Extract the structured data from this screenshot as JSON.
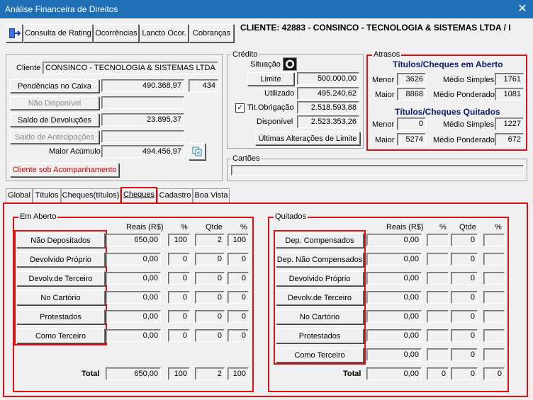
{
  "window": {
    "title": "Análise Financeira de Direitos",
    "close": "✕"
  },
  "toolbar": {
    "items": [
      "Consulta de Rating",
      "Ocorrências",
      "Lancto Ocor.",
      "Cobranças"
    ],
    "client_header": "CLIENTE: 42883 - CONSINCO - TECNOLOGIA & SISTEMAS LTDA  /  I"
  },
  "cliente": {
    "label": "Cliente",
    "name": "CONSINCO - TECNOLOGIA & SISTEMAS LTDA",
    "pendencias_btn": "Pendências no Caixa",
    "pendencias_val": "490.368,97",
    "pendencias_qtd": "434",
    "nao_disponivel_btn": "Não Disponível",
    "nao_disponivel_val": "",
    "saldo_devolucoes_btn": "Saldo de Devoluções",
    "saldo_devolucoes_val": "23.895,37",
    "saldo_antecipacoes_btn": "Saldo de Antecipações",
    "saldo_antecipacoes_val": "",
    "maior_acumulo_label": "Maior Acúmulo",
    "maior_acumulo_val": "494.456,97",
    "acompanhamento_btn": "Cliente sob Acompanhamento"
  },
  "credito": {
    "title": "Crédito",
    "situacao_label": "Situação",
    "limite_btn": "Limite",
    "limite_val": "500.000,00",
    "utilizado_label": "Utilizado",
    "utilizado_val": "495.240,62",
    "tit_obrig_label": "Tit.Obrigação",
    "tit_obrig_checked": true,
    "tit_obrig_val": "2.518.593,88",
    "disponivel_label": "Disponível",
    "disponivel_val": "2.523.353,26",
    "ultimas_btn": "Últimas Alterações de Limite"
  },
  "atrasos": {
    "title": "Atrasos",
    "aberto_title": "Títulos/Cheques em Aberto",
    "quitados_title": "Títulos/Cheques Quitados",
    "menor_label": "Menor",
    "maior_label": "Maior",
    "medio_simples_label": "Médio Simples",
    "medio_ponderado_label": "Médio Ponderado",
    "aberto": {
      "menor": "3626",
      "maior": "8868",
      "medio_simples": "1761",
      "medio_ponderado": "1081"
    },
    "quitados": {
      "menor": "0",
      "maior": "5274",
      "medio_simples": "1227",
      "medio_ponderado": "672"
    }
  },
  "cartoes": {
    "title": "Cartões",
    "value": ""
  },
  "tabs": [
    "Global",
    "Títulos",
    "Cheques(títulos)",
    "Cheques",
    "Cadastro",
    "Boa Vista"
  ],
  "active_tab": "Cheques",
  "em_aberto": {
    "title": "Em Aberto",
    "headers": {
      "reais": "Reais (R$)",
      "pct1": "%",
      "qtde": "Qtde",
      "pct2": "%"
    },
    "rows": [
      {
        "label": "Não Depositados",
        "reais": "650,00",
        "pct1": "100",
        "qtde": "2",
        "pct2": "100"
      },
      {
        "label": "Devolvido Próprio",
        "reais": "0,00",
        "pct1": "0",
        "qtde": "0",
        "pct2": "0"
      },
      {
        "label": "Devolv.de Terceiro",
        "reais": "0,00",
        "pct1": "0",
        "qtde": "0",
        "pct2": "0"
      },
      {
        "label": "No Cartório",
        "reais": "0,00",
        "pct1": "0",
        "qtde": "0",
        "pct2": "0"
      },
      {
        "label": "Protestados",
        "reais": "0,00",
        "pct1": "0",
        "qtde": "0",
        "pct2": "0"
      },
      {
        "label": "Como Terceiro",
        "reais": "0,00",
        "pct1": "0",
        "qtde": "0",
        "pct2": "0"
      }
    ],
    "total_label": "Total",
    "total": {
      "reais": "650,00",
      "pct1": "100",
      "qtde": "2",
      "pct2": "100"
    }
  },
  "quitados": {
    "title": "Quitados",
    "headers": {
      "reais": "Reais (R$)",
      "pct1": "%",
      "qtde": "Qtde",
      "pct2": "%"
    },
    "rows": [
      {
        "label": "Dep. Compensados",
        "reais": "0,00",
        "pct1": "",
        "qtde": "0",
        "pct2": ""
      },
      {
        "label": "Dep. Não Compensados",
        "reais": "0,00",
        "pct1": "",
        "qtde": "0",
        "pct2": ""
      },
      {
        "label": "Devolvido Próprio",
        "reais": "0,00",
        "pct1": "",
        "qtde": "0",
        "pct2": ""
      },
      {
        "label": "Devolv.de Terceiro",
        "reais": "0,00",
        "pct1": "",
        "qtde": "0",
        "pct2": ""
      },
      {
        "label": "No Cartório",
        "reais": "0,00",
        "pct1": "",
        "qtde": "0",
        "pct2": ""
      },
      {
        "label": "Protestados",
        "reais": "0,00",
        "pct1": "",
        "qtde": "0",
        "pct2": ""
      },
      {
        "label": "Como Terceiro",
        "reais": "0,00",
        "pct1": "",
        "qtde": "0",
        "pct2": ""
      }
    ],
    "total_label": "Total",
    "total": {
      "reais": "0,00",
      "pct1": "0",
      "qtde": "0",
      "pct2": "0"
    }
  },
  "colors": {
    "titlebar": "#1e6fb5",
    "highlight_red": "#d11111",
    "heading_navy": "#0a1e6e",
    "alert_text": "#d00000"
  }
}
